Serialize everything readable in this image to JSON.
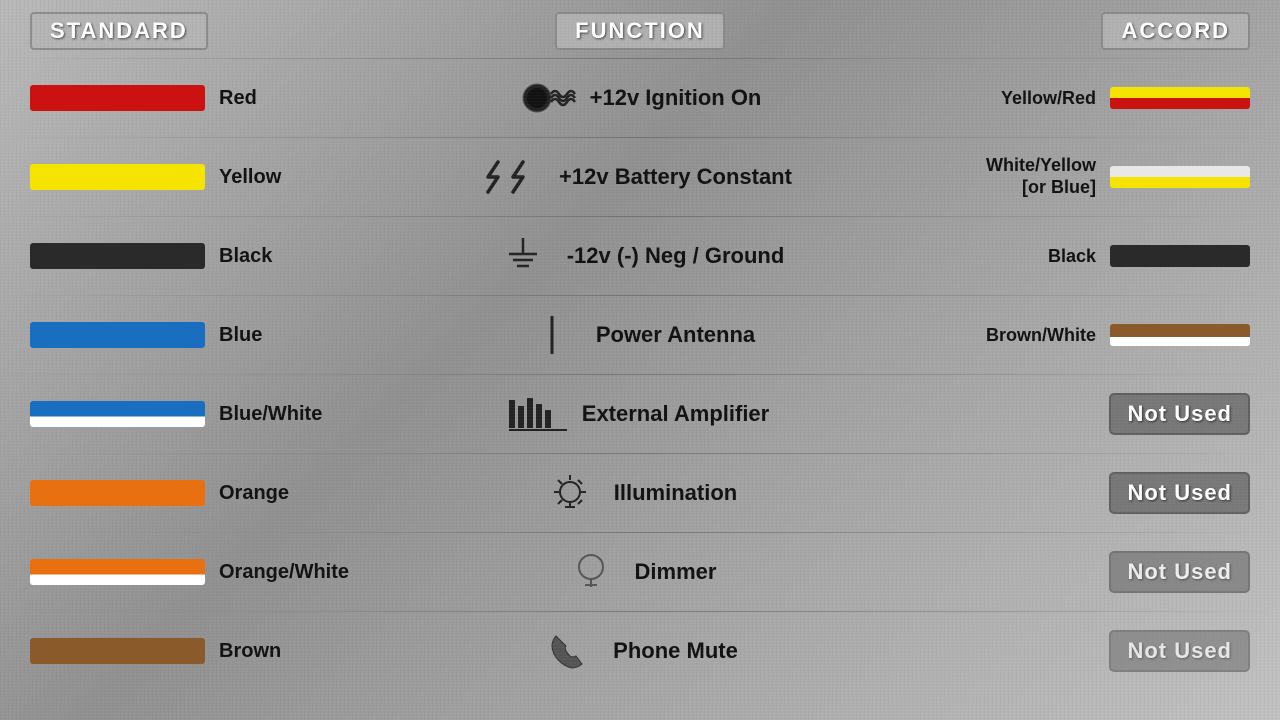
{
  "headers": {
    "standard": "STANDARD",
    "function": "FUNCTION",
    "accord": "ACCORD"
  },
  "rows": [
    {
      "id": "row-ignition",
      "standard": {
        "wire_class": "wire-red",
        "label": "Red"
      },
      "function": {
        "icon": "ignition-icon",
        "label": "+12v  Ignition On"
      },
      "accord": {
        "type": "wire",
        "wire_class": "wire-yellow-red",
        "label": "Yellow/Red"
      }
    },
    {
      "id": "row-battery",
      "standard": {
        "wire_class": "wire-yellow",
        "label": "Yellow"
      },
      "function": {
        "icon": "battery-icon",
        "label": "+12v  Battery Constant"
      },
      "accord": {
        "type": "wire",
        "wire_class": "wire-white-yellow",
        "label": "White/Yellow\n[or Blue]"
      }
    },
    {
      "id": "row-ground",
      "standard": {
        "wire_class": "wire-black",
        "label": "Black"
      },
      "function": {
        "icon": "ground-icon",
        "label": "-12v (-) Neg / Ground"
      },
      "accord": {
        "type": "wire",
        "wire_class": "wire-black-acc",
        "label": "Black"
      }
    },
    {
      "id": "row-antenna",
      "standard": {
        "wire_class": "wire-blue",
        "label": "Blue"
      },
      "function": {
        "icon": "antenna-icon",
        "label": "Power  Antenna"
      },
      "accord": {
        "type": "wire",
        "wire_class": "wire-brown-white",
        "label": "Brown/White"
      }
    },
    {
      "id": "row-amplifier",
      "standard": {
        "wire_class": "wire-blue-white",
        "label": "Blue/White"
      },
      "function": {
        "icon": "amplifier-icon",
        "label": "External Amplifier"
      },
      "accord": {
        "type": "badge",
        "label": "Not Used"
      }
    },
    {
      "id": "row-illumination",
      "standard": {
        "wire_class": "wire-orange",
        "label": "Orange"
      },
      "function": {
        "icon": "illumination-icon",
        "label": "Illumination"
      },
      "accord": {
        "type": "badge",
        "label": "Not Used"
      }
    },
    {
      "id": "row-dimmer",
      "standard": {
        "wire_class": "wire-orange-white",
        "label": "Orange/White"
      },
      "function": {
        "icon": "dimmer-icon",
        "label": "Dimmer"
      },
      "accord": {
        "type": "badge",
        "label": "Not Used"
      }
    },
    {
      "id": "row-phone",
      "standard": {
        "wire_class": "wire-brown",
        "label": "Brown"
      },
      "function": {
        "icon": "phone-icon",
        "label": "Phone Mute"
      },
      "accord": {
        "type": "badge",
        "label": "Not Used"
      }
    }
  ]
}
